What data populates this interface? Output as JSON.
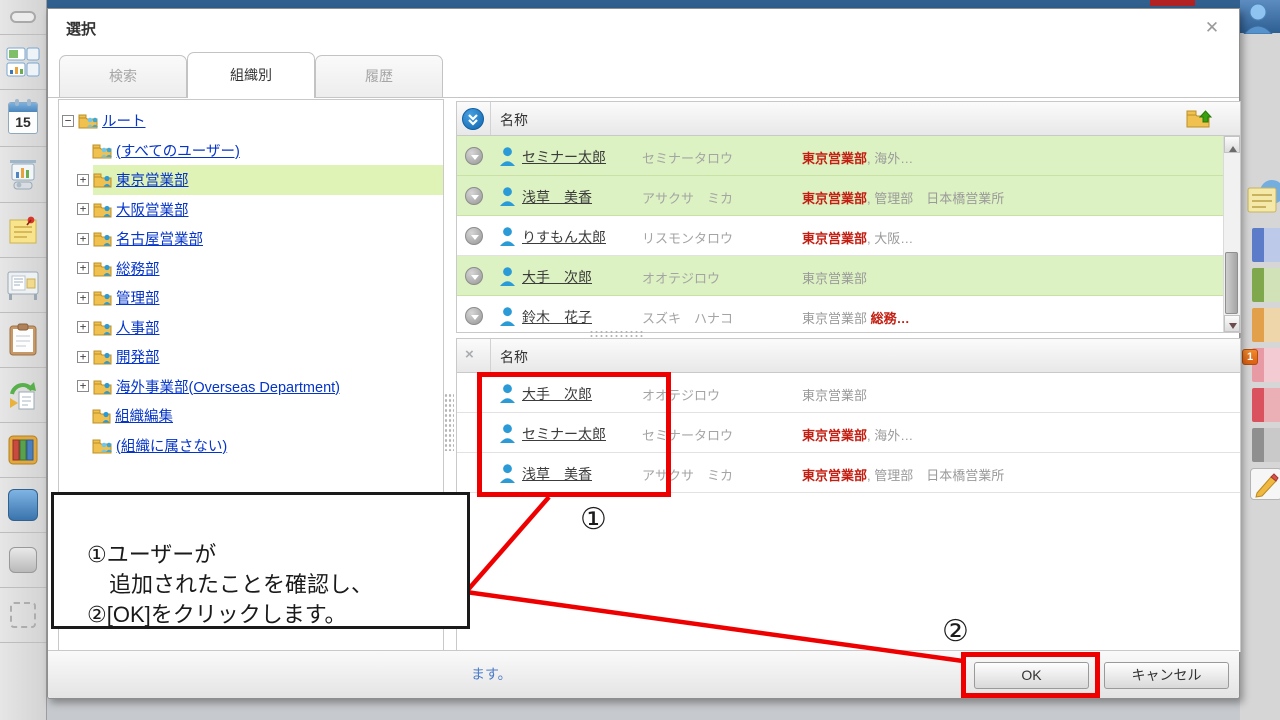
{
  "dialog": {
    "title": "選択",
    "close_icon": "✕",
    "tabs": [
      {
        "label": "検索"
      },
      {
        "label": "組織別"
      },
      {
        "label": "履歴"
      }
    ],
    "footer": {
      "hint_visible": "ます。",
      "ok_label": "OK",
      "cancel_label": "キャンセル"
    }
  },
  "tree": {
    "items": [
      {
        "label": "ルート",
        "toggle": "−"
      },
      {
        "label": "(すべてのユーザー)"
      },
      {
        "label": "東京営業部",
        "toggle": "+"
      },
      {
        "label": "大阪営業部",
        "toggle": "+"
      },
      {
        "label": "名古屋営業部",
        "toggle": "+"
      },
      {
        "label": "総務部",
        "toggle": "+"
      },
      {
        "label": "管理部",
        "toggle": "+"
      },
      {
        "label": "人事部",
        "toggle": "+"
      },
      {
        "label": "開発部",
        "toggle": "+"
      },
      {
        "label": "海外事業部(Overseas Department)",
        "toggle": "+"
      },
      {
        "label": "組織編集"
      },
      {
        "label": "(組織に属さない)"
      }
    ]
  },
  "available_list": {
    "header": "名称",
    "rows": [
      {
        "name": "セミナー太郎",
        "kana": "セミナータロウ",
        "org_red": "東京営業部",
        "org_gray": ", 海外…"
      },
      {
        "name": "浅草　美香",
        "kana": "アサクサ　ミカ",
        "org_red": "東京営業部",
        "org_gray": ", 管理部　日本橋営業所"
      },
      {
        "name": "りすもん太郎",
        "kana": "リスモンタロウ",
        "org_red": "東京営業部",
        "org_gray": ", 大阪…"
      },
      {
        "name": "大手　次郎",
        "kana": "オオテジロウ",
        "org_gray": "東京営業部"
      },
      {
        "name": "鈴木　花子",
        "kana": "スズキ　ハナコ",
        "org_gray": "東京営業部 ",
        "org_red2": "総務…"
      }
    ]
  },
  "selected_list": {
    "header": "名称",
    "remove_icon": "×",
    "rows": [
      {
        "name": "大手　次郎",
        "kana": "オオテジロウ",
        "org_gray": "東京営業部"
      },
      {
        "name": "セミナー太郎",
        "kana": "セミナータロウ",
        "org_red": "東京営業部",
        "org_gray": ", 海外…"
      },
      {
        "name": "浅草　美香",
        "kana": "アサクサ　ミカ",
        "org_red": "東京営業部",
        "org_gray": ", 管理部　日本橋営業所"
      }
    ]
  },
  "annotation": {
    "step1_label": "①",
    "step2_label": "②",
    "note_lines": [
      "①ユーザーが",
      "　追加されたことを確認し、",
      "②[OK]をクリックします。"
    ]
  },
  "left_rail": {
    "calendar_day": "15"
  },
  "right_rail": {
    "badge_count": "1"
  },
  "colors": {
    "annotation_red": "#ee0000",
    "row_highlight_green": "#ddf2c2",
    "tree_link_blue": "#0434c9",
    "org_text_red": "#c41e12",
    "top_bar_navy": "#31608f"
  }
}
